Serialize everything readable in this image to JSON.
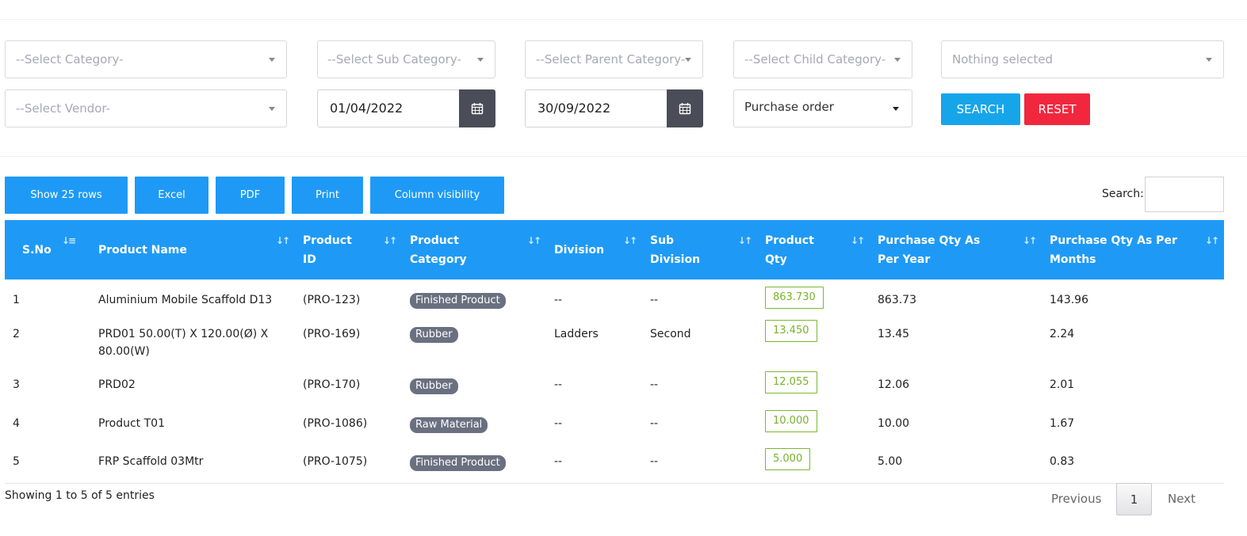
{
  "filters": {
    "category": "--Select Category-",
    "sub_category": "--Select Sub Category-",
    "parent_category": "--Select Parent Category-",
    "child_category": "--Select Child Category-",
    "nothing_selected": "Nothing selected",
    "vendor": "--Select Vendor-",
    "from_date": "01/04/2022",
    "to_date": "30/09/2022",
    "type": "Purchase order",
    "search_label": "SEARCH",
    "reset_label": "RESET"
  },
  "toolbar": {
    "show_rows": "Show 25 rows",
    "excel": "Excel",
    "pdf": "PDF",
    "print": "Print",
    "column_visibility": "Column visibility",
    "search_label": "Search:"
  },
  "table": {
    "headers": [
      "S.No",
      "Product Name",
      "Product ID",
      "Product Category",
      "Division",
      "Sub Division",
      "Product Qty",
      "Purchase Qty As Per Year",
      "Purchase Qty As Per Months"
    ],
    "rows": [
      {
        "sno": "1",
        "name": "Aluminium Mobile Scaffold D13",
        "id": "(PRO-123)",
        "category": "Finished Product",
        "division": "--",
        "sub_division": "--",
        "qty": "863.730",
        "per_year": "863.73",
        "per_month": "143.96"
      },
      {
        "sno": "2",
        "name": "PRD01 50.00(T) X 120.00(Ø) X 80.00(W)",
        "id": "(PRO-169)",
        "category": "Rubber",
        "division": "Ladders",
        "sub_division": "Second",
        "qty": "13.450",
        "per_year": "13.45",
        "per_month": "2.24"
      },
      {
        "sno": "3",
        "name": "PRD02",
        "id": "(PRO-170)",
        "category": "Rubber",
        "division": "--",
        "sub_division": "--",
        "qty": "12.055",
        "per_year": "12.06",
        "per_month": "2.01"
      },
      {
        "sno": "4",
        "name": "Product T01",
        "id": "(PRO-1086)",
        "category": "Raw Material",
        "division": "--",
        "sub_division": "--",
        "qty": "10.000",
        "per_year": "10.00",
        "per_month": "1.67"
      },
      {
        "sno": "5",
        "name": "FRP Scaffold 03Mtr",
        "id": "(PRO-1075)",
        "category": "Finished Product",
        "division": "--",
        "sub_division": "--",
        "qty": "5.000",
        "per_year": "5.00",
        "per_month": "0.83"
      }
    ]
  },
  "footer": {
    "info": "Showing 1 to 5 of 5 entries",
    "previous": "Previous",
    "current_page": "1",
    "next": "Next"
  },
  "colors": {
    "primary": "#1e9af6",
    "search": "#17a5ea",
    "reset": "#f1273e",
    "badge": "#6b7080",
    "qty_green": "#78b32a"
  }
}
